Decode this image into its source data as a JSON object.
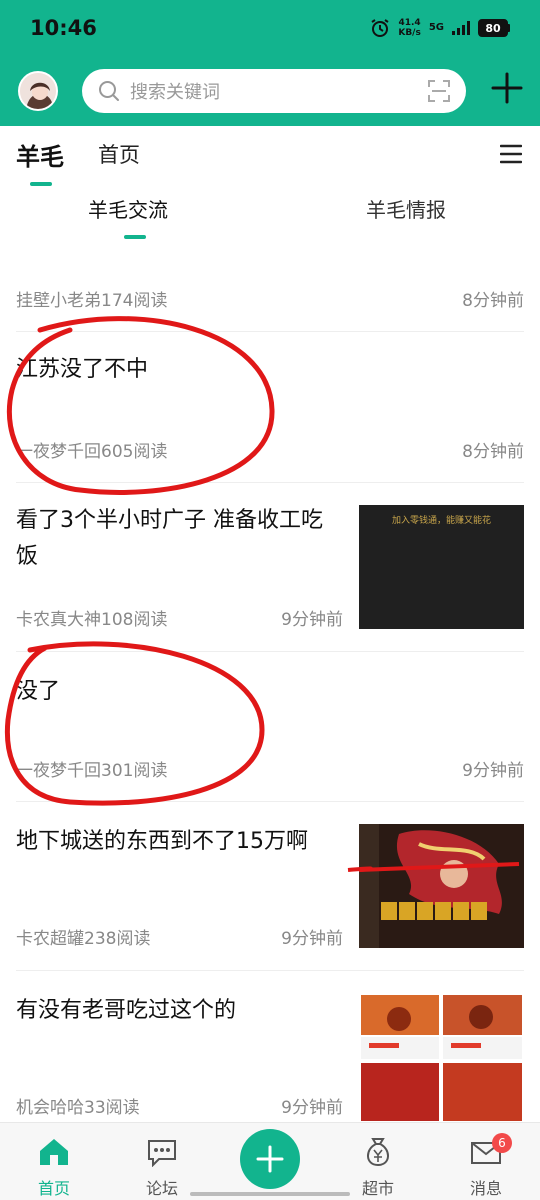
{
  "status": {
    "time": "10:46",
    "speed_value": "41.4",
    "speed_unit": "KB/s",
    "network": "5G",
    "battery": "80"
  },
  "search": {
    "placeholder": "搜索关键词"
  },
  "tabs": {
    "active": "羊毛",
    "home": "首页"
  },
  "subtabs": {
    "left": "羊毛交流",
    "right": "羊毛情报"
  },
  "posts": [
    {
      "title": "",
      "meta": "挂壁小老弟174阅读",
      "time": "8分钟前"
    },
    {
      "title": "江苏没了不中",
      "meta": "一夜梦千回605阅读",
      "time": "8分钟前"
    },
    {
      "title": "看了3个半小时广子 准备收工吃饭",
      "meta": "卡农真大神108阅读",
      "time": "9分钟前",
      "thumb_text": "加入零钱通，能赚又能花"
    },
    {
      "title": "没了",
      "meta": "一夜梦千回301阅读",
      "time": "9分钟前"
    },
    {
      "title": "地下城送的东西到不了15万啊",
      "meta": "卡农超罐238阅读",
      "time": "9分钟前"
    },
    {
      "title": "有没有老哥吃过这个的",
      "meta": "机会哈哈33阅读",
      "time": "9分钟前"
    }
  ],
  "nav": {
    "home": "首页",
    "forum": "论坛",
    "market": "超市",
    "messages": "消息",
    "badge": "6"
  },
  "colors": {
    "brand": "#12b48e",
    "annotation": "#e01818"
  },
  "icons": [
    "alarm-icon",
    "search-icon",
    "scan-icon",
    "plus-icon",
    "menu-icon",
    "home-icon",
    "chat-icon",
    "add-icon",
    "moneybag-icon",
    "mail-icon"
  ]
}
